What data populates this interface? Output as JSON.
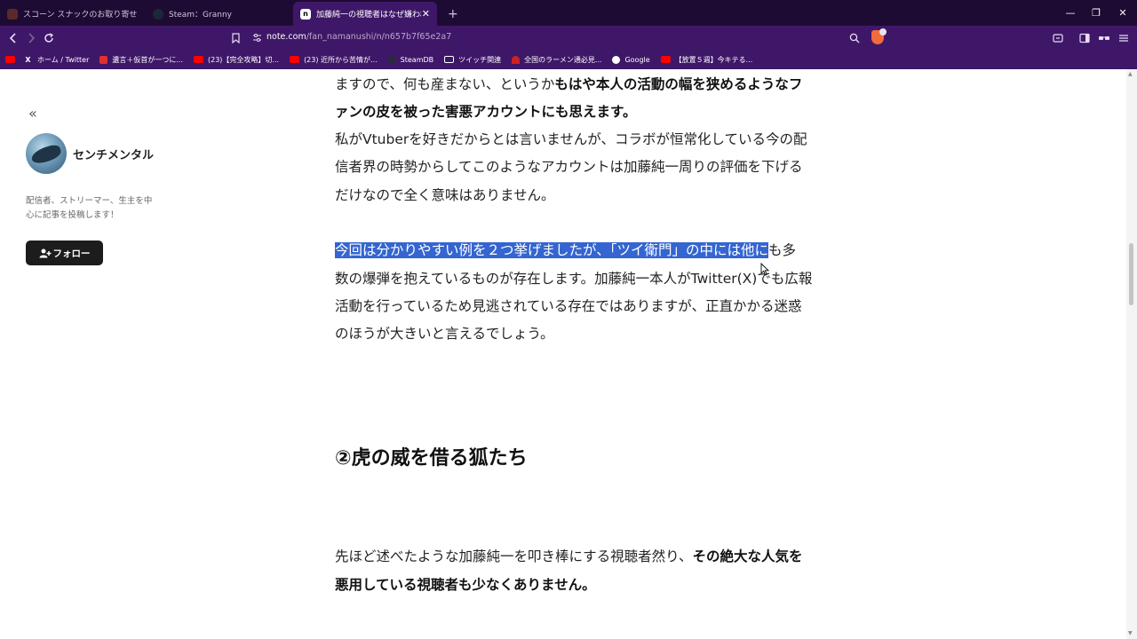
{
  "tabs": [
    {
      "title": "スコーン スナックのお取り寄せ | 公式通販",
      "favicon": "#5a2a2a"
    },
    {
      "title": "Steam：Granny",
      "favicon": "#1b2838"
    },
    {
      "title": "加藤純一の視聴者はなぜ嫌われて",
      "favicon": "#ffffff",
      "favicon_letter": "n",
      "close": "✕"
    }
  ],
  "new_tab": "+",
  "window_controls": [
    "—",
    "❐",
    "✕"
  ],
  "address": {
    "host": "note.com",
    "path": "/fan_namanushi/n/n657b7f65e2a7"
  },
  "bookmarks": [
    {
      "label": "",
      "icon_color": "#ff0000"
    },
    {
      "label": "ホーム / Twitter",
      "icon_color": "#000000",
      "icon_text": "X"
    },
    {
      "label": "遺言＋仮首が一つに...",
      "icon_color": "#e03030"
    },
    {
      "label": "(23)【完全攻略】切...",
      "icon_color": "#ff0000"
    },
    {
      "label": "(23) 近所から苦情が...",
      "icon_color": "#ff0000"
    },
    {
      "label": "SteamDB",
      "icon_color": "#2a2a3a"
    },
    {
      "label": "ツイッチ関連",
      "icon_color": "#3f1768"
    },
    {
      "label": "全国のラーメン通必見...",
      "icon_color": "#d02020"
    },
    {
      "label": "Google",
      "icon_color": "#ffffff"
    },
    {
      "label": "【放置５週】今キテる...",
      "icon_color": "#ff0000"
    }
  ],
  "sidebar": {
    "author": "センチメンタル",
    "bio_line1": "配信者、ストリーマー、生主を中",
    "bio_line2": "心に記事を投稿します！",
    "follow_label": "フォロー",
    "collapse_icon": "«"
  },
  "article": {
    "p1_l1_a": "ますので、何も産まない、というか",
    "p1_l1_b": "もはや本人の活動の幅を狭めるようなフ",
    "p1_l2_b": "ァンの皮を被った害悪アカウントにも思えます。",
    "p2_l1": "私がVtuberを好きだからとは言いませんが、コラボが恒常化している今の配",
    "p2_l2": "信者界の時勢からしてこのようなアカウントは加藤純一周りの評価を下げる",
    "p2_l3": "だけなので全く意味はありません。",
    "p3_l1_sel": "今回は分かりやすい例を２つ挙げましたが、「ツイ衛門」の中には他に",
    "p3_l1_rest": "も多",
    "p3_l2": "数の爆弾を抱えているものが存在します。加藤純一本人がTwitter(X)でも広報",
    "p3_l3": "活動を行っているため見逃されている存在ではありますが、正直かかる迷惑",
    "p3_l4": "のほうが大きいと言えるでしょう。",
    "heading": "②虎の威を借る狐たち",
    "p4_l1_a": "先ほど述べたような加藤純一を叩き棒にする視聴者然り、",
    "p4_l1_b": "その絶大な人気を",
    "p4_l2_b": "悪用している視聴者も少なくありません。"
  }
}
